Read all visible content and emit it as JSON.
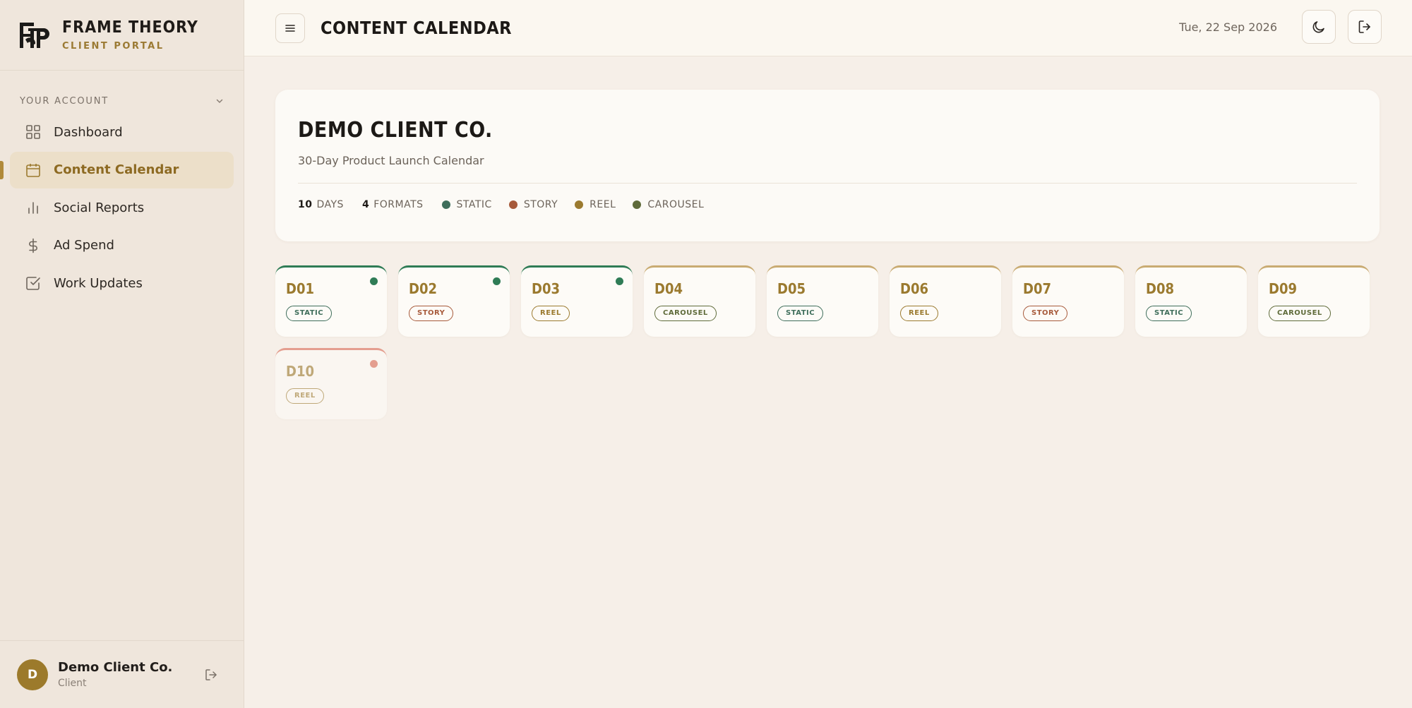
{
  "brand": {
    "title": "FRAME THEORY",
    "subtitle": "CLIENT PORTAL",
    "logo_icon": "frame-theory-logo"
  },
  "sidebar": {
    "section_label": "YOUR ACCOUNT",
    "items": [
      {
        "label": "Dashboard",
        "icon": "grid-icon",
        "active": false
      },
      {
        "label": "Content Calendar",
        "icon": "calendar-icon",
        "active": true
      },
      {
        "label": "Social Reports",
        "icon": "bar-chart-icon",
        "active": false
      },
      {
        "label": "Ad Spend",
        "icon": "dollar-icon",
        "active": false
      },
      {
        "label": "Work Updates",
        "icon": "check-square-icon",
        "active": false
      }
    ],
    "user": {
      "initial": "D",
      "name": "Demo Client Co.",
      "role": "Client"
    }
  },
  "topbar": {
    "title": "CONTENT CALENDAR",
    "date": "Tue, 22 Sep 2026"
  },
  "hero": {
    "title": "DEMO CLIENT CO.",
    "subtitle": "30-Day Product Launch Calendar",
    "days_count": "10",
    "days_label": "DAYS",
    "formats_count": "4",
    "formats_label": "FORMATS",
    "legend": [
      {
        "label": "STATIC",
        "color": "#3f6e5b"
      },
      {
        "label": "STORY",
        "color": "#a75a3b"
      },
      {
        "label": "REEL",
        "color": "#9b7a2f"
      },
      {
        "label": "CAROUSEL",
        "color": "#5f6b3a"
      }
    ]
  },
  "colors": {
    "accent": "#9b7a2f",
    "static": "#3f6e5b",
    "story": "#a75a3b",
    "reel": "#9b7a2f",
    "carousel": "#5f6b3a",
    "done_dot": "#2f7c56",
    "pending_dot": "#d96a55"
  },
  "days": [
    {
      "day": "D01",
      "format": "STATIC",
      "status": "done"
    },
    {
      "day": "D02",
      "format": "STORY",
      "status": "done"
    },
    {
      "day": "D03",
      "format": "REEL",
      "status": "done"
    },
    {
      "day": "D04",
      "format": "CAROUSEL",
      "status": ""
    },
    {
      "day": "D05",
      "format": "STATIC",
      "status": ""
    },
    {
      "day": "D06",
      "format": "REEL",
      "status": ""
    },
    {
      "day": "D07",
      "format": "STORY",
      "status": ""
    },
    {
      "day": "D08",
      "format": "STATIC",
      "status": ""
    },
    {
      "day": "D09",
      "format": "CAROUSEL",
      "status": ""
    },
    {
      "day": "D10",
      "format": "REEL",
      "status": "pending"
    }
  ]
}
